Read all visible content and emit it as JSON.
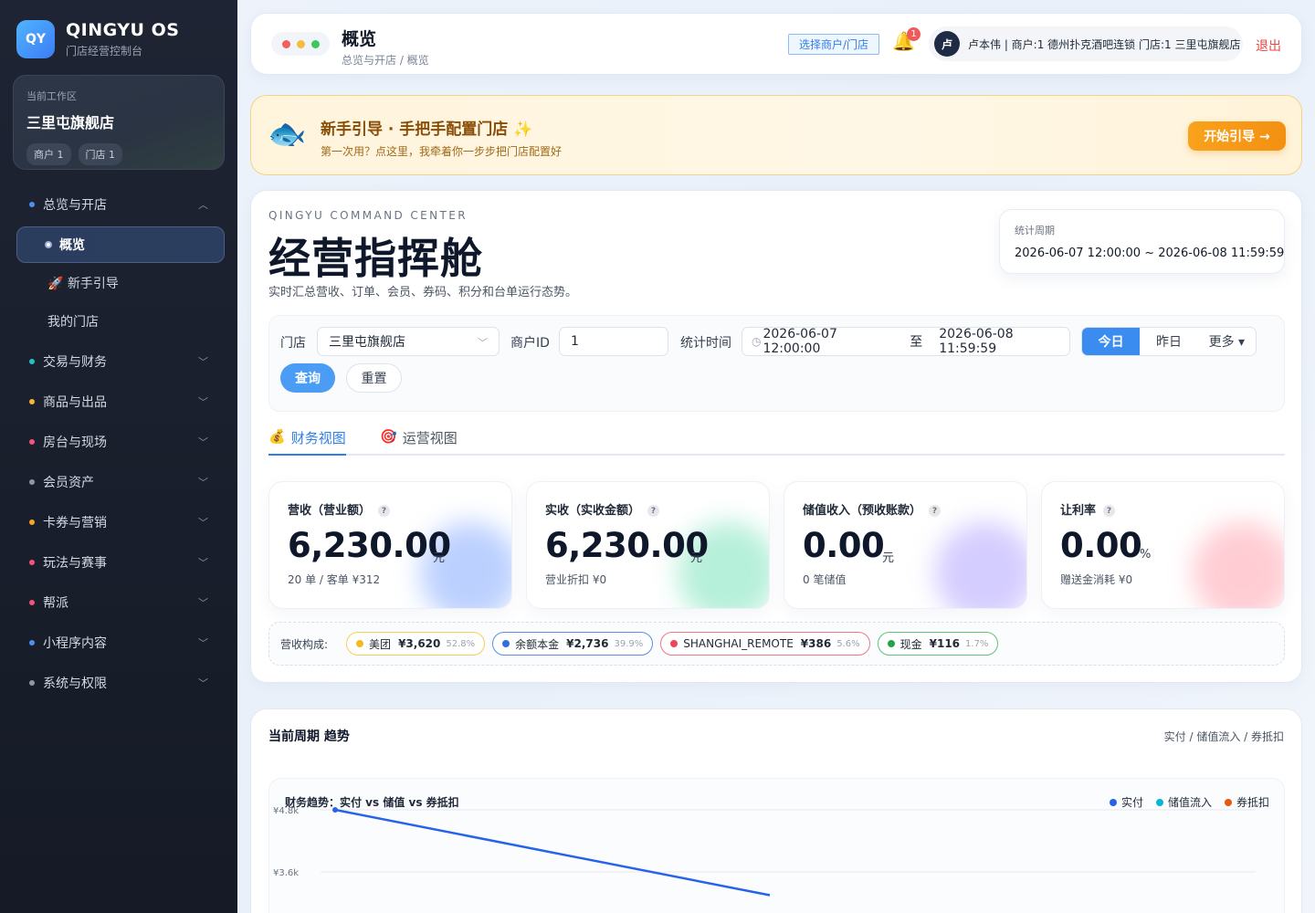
{
  "sidebar": {
    "logo": "QY",
    "title": "QINGYU OS",
    "subtitle": "门店经营控制台",
    "workspace": {
      "label": "当前工作区",
      "name": "三里屯旗舰店",
      "chips": [
        "商户 1",
        "门店 1"
      ]
    },
    "groups": [
      {
        "label": "总览与开店",
        "color": "#4d8ff2",
        "expanded": true
      },
      {
        "label": "交易与财务",
        "color": "#22c1c3"
      },
      {
        "label": "商品与出品",
        "color": "#f5b43c"
      },
      {
        "label": "房台与现场",
        "color": "#f2557a"
      },
      {
        "label": "会员资产",
        "color": "#8f96a8"
      },
      {
        "label": "卡券与营销",
        "color": "#f5a623"
      },
      {
        "label": "玩法与赛事",
        "color": "#f2557a"
      },
      {
        "label": "帮派",
        "color": "#f2557a"
      },
      {
        "label": "小程序内容",
        "color": "#4d8ff2"
      },
      {
        "label": "系统与权限",
        "color": "#8f96a8"
      }
    ],
    "sub_items": [
      "概览",
      "🚀 新手引导",
      "我的门店"
    ]
  },
  "topbar": {
    "title": "概览",
    "breadcrumb": "总览与开店 / 概览",
    "select_store": "选择商户/门店",
    "bell_count": "1",
    "user_avatar": "卢",
    "user_text": "卢本伟 | 商户:1 德州扑克酒吧连锁 门店:1 三里屯旗舰店",
    "logout": "退出"
  },
  "guide": {
    "title": "新手引导 · 手把手配置门店 ✨",
    "subtitle": "第一次用？点这里，我牵着你一步步把门店配置好",
    "button": "开始引导 →"
  },
  "command": {
    "eyebrow": "QINGYU COMMAND CENTER",
    "title": "经营指挥舱",
    "description": "实时汇总营收、订单、会员、券码、积分和台单运行态势。",
    "period_label": "统计周期",
    "period_value": "2026-06-07 12:00:00 ~ 2026-06-08 11:59:59"
  },
  "filters": {
    "store_label": "门店",
    "store_value": "三里屯旗舰店",
    "merchant_label": "商户ID",
    "merchant_value": "1",
    "time_label": "统计时间",
    "time_start": "2026-06-07 12:00:00",
    "time_sep": "至",
    "time_end": "2026-06-08 11:59:59",
    "quick": [
      "今日",
      "昨日",
      "更多 ▾"
    ],
    "query": "查询",
    "reset": "重置"
  },
  "tabs": [
    {
      "icon": "💰",
      "label": "财务视图",
      "active": true
    },
    {
      "icon": "🎯",
      "label": "运营视图"
    }
  ],
  "kpis": [
    {
      "label": "营收（营业额）",
      "value": "6,230.00",
      "unit": "元",
      "sub": "20 单 / 客单 ¥312",
      "glow": "#7aa2ff"
    },
    {
      "label": "实收（实收金额）",
      "value": "6,230.00",
      "unit": "元",
      "sub": "营业折扣 ¥0",
      "glow": "#6ee0b5"
    },
    {
      "label": "储值收入（预收账款）",
      "value": "0.00",
      "unit": "元",
      "sub": "0 笔储值",
      "glow": "#a99bff"
    },
    {
      "label": "让利率",
      "value": "0.00",
      "unit": "%",
      "sub": "赠送金消耗 ¥0",
      "glow": "#ff9aa8"
    }
  ],
  "revenue_mix": {
    "label": "营收构成:",
    "items": [
      {
        "name": "美团",
        "amount": "¥3,620",
        "pct": "52.8%",
        "color": "#f5b820",
        "border": "#f6cf57"
      },
      {
        "name": "余额本金",
        "amount": "¥2,736",
        "pct": "39.9%",
        "color": "#2f6fe0",
        "border": "#5b8de8"
      },
      {
        "name": "SHANGHAI_REMOTE",
        "amount": "¥386",
        "pct": "5.6%",
        "color": "#ef4459",
        "border": "#ef7787"
      },
      {
        "name": "现金",
        "amount": "¥116",
        "pct": "1.7%",
        "color": "#22a447",
        "border": "#5fc27b"
      }
    ]
  },
  "trend": {
    "title": "当前周期 趋势",
    "right_label": "实付 / 储值流入 / 券抵扣",
    "chart_title": "财务趋势：实付 vs 储值 vs 券抵扣"
  },
  "chart_data": {
    "type": "line",
    "title": "财务趋势：实付 vs 储值 vs 券抵扣",
    "y_ticks": [
      "¥4.8k",
      "¥3.6k"
    ],
    "ylim": [
      3600,
      4800
    ],
    "series": [
      {
        "name": "实付",
        "color": "#2563eb",
        "values": [
          4800,
          3150
        ]
      },
      {
        "name": "储值流入",
        "color": "#06b6d4",
        "values": []
      },
      {
        "name": "券抵扣",
        "color": "#ea580c",
        "values": []
      }
    ],
    "legend": "top-right",
    "grid": true
  }
}
